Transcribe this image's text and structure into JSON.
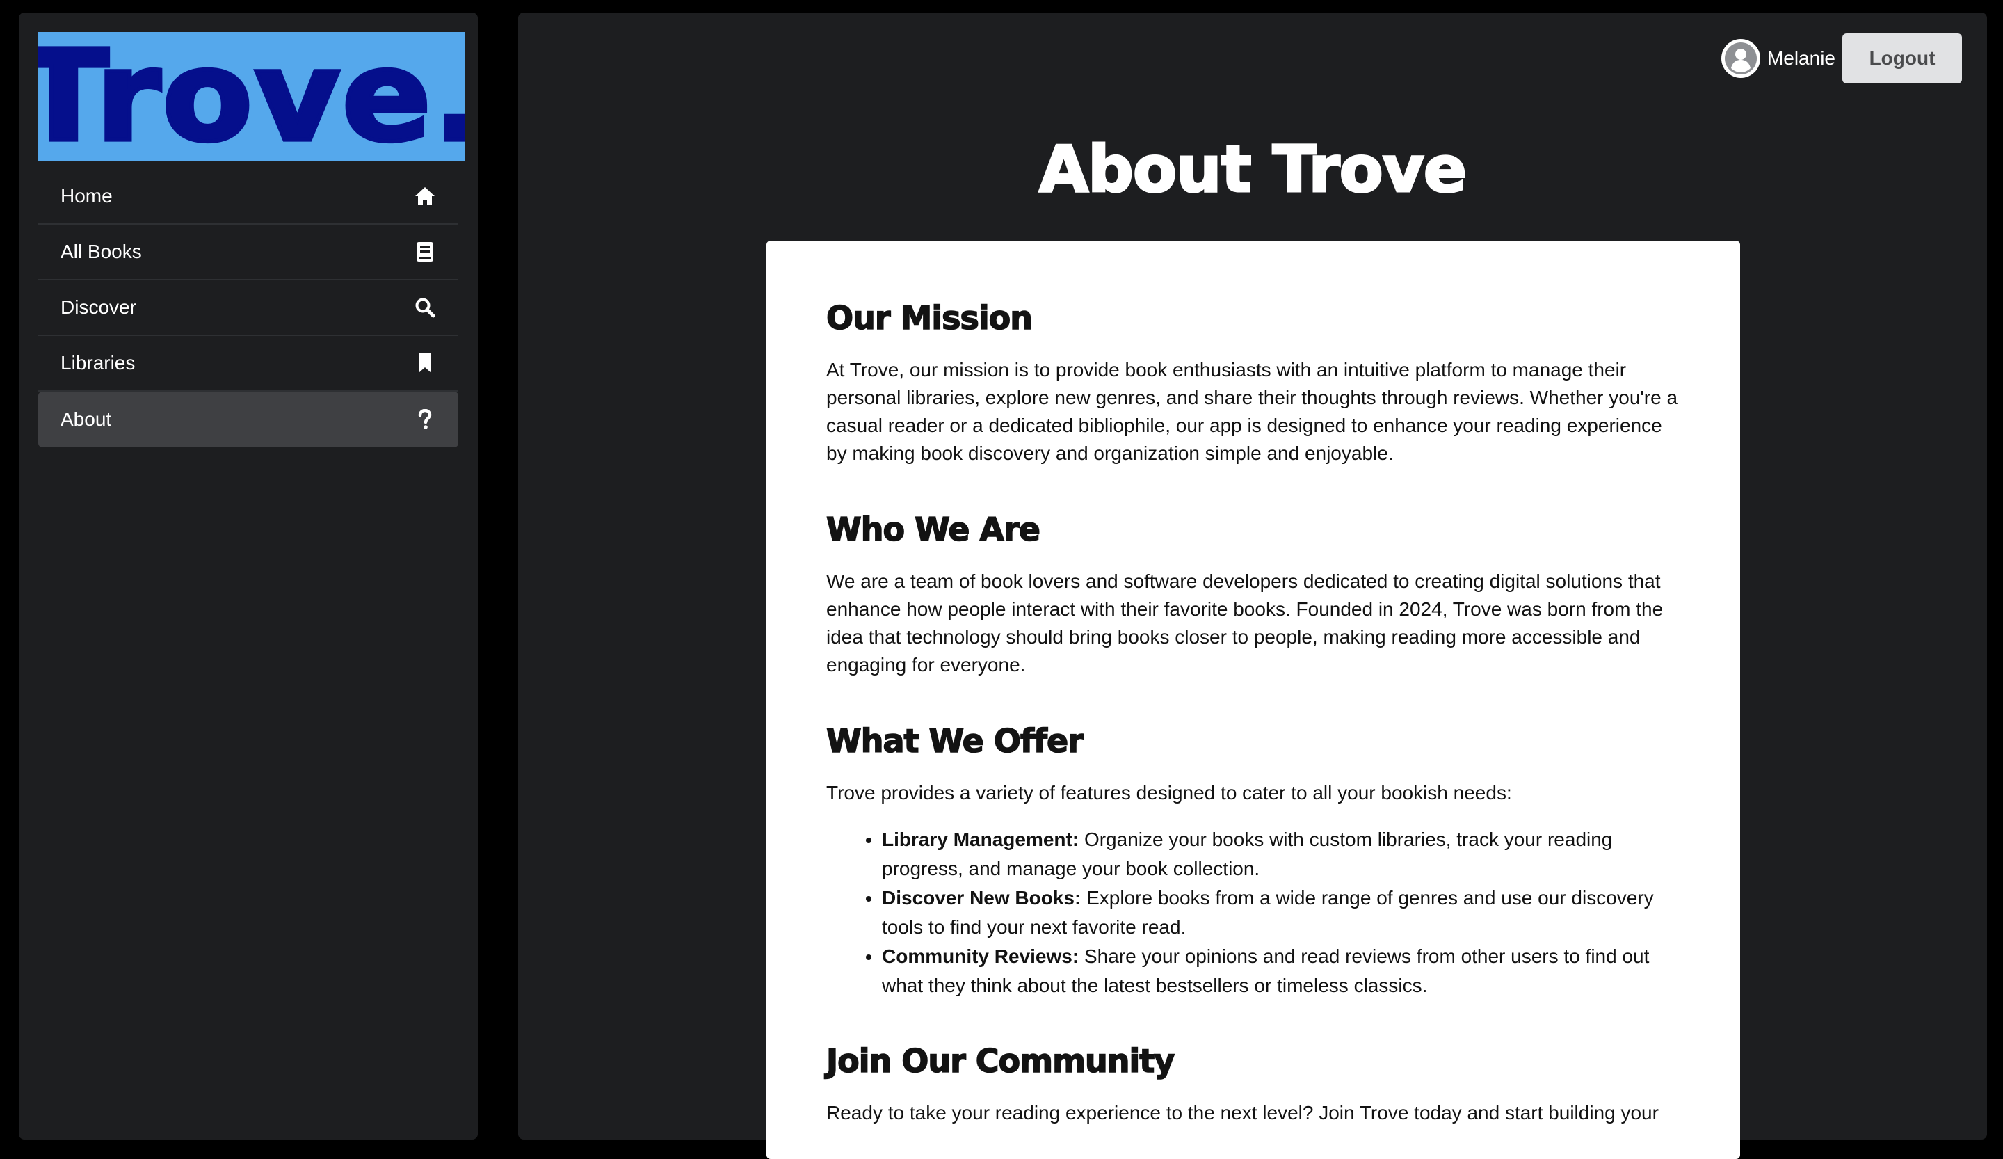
{
  "logo": {
    "text": "Trove."
  },
  "sidebar": {
    "items": [
      {
        "label": "Home",
        "icon": "home-icon",
        "active": false
      },
      {
        "label": "All Books",
        "icon": "book-icon",
        "active": false
      },
      {
        "label": "Discover",
        "icon": "search-icon",
        "active": false
      },
      {
        "label": "Libraries",
        "icon": "bookmark-icon",
        "active": false
      },
      {
        "label": "About",
        "icon": "question-icon",
        "active": true
      }
    ]
  },
  "user": {
    "name": "Melanie",
    "logout_label": "Logout"
  },
  "page": {
    "title": "About Trove"
  },
  "sections": {
    "mission": {
      "heading": "Our Mission",
      "body": "At Trove, our mission is to provide book enthusiasts with an intuitive platform to manage their personal libraries, explore new genres, and share their thoughts through reviews. Whether you're a casual reader or a dedicated bibliophile, our app is designed to enhance your reading experience by making book discovery and organization simple and enjoyable."
    },
    "who": {
      "heading": "Who We Are",
      "body": "We are a team of book lovers and software developers dedicated to creating digital solutions that enhance how people interact with their favorite books. Founded in 2024, Trove was born from the idea that technology should bring books closer to people, making reading more accessible and engaging for everyone."
    },
    "offer": {
      "heading": "What We Offer",
      "intro": "Trove provides a variety of features designed to cater to all your bookish needs:",
      "items": [
        {
          "title": "Library Management:",
          "text": " Organize your books with custom libraries, track your reading progress, and manage your book collection."
        },
        {
          "title": "Discover New Books:",
          "text": " Explore books from a wide range of genres and use our discovery tools to find your next favorite read."
        },
        {
          "title": "Community Reviews:",
          "text": " Share your opinions and read reviews from other users to find out what they think about the latest bestsellers or timeless classics."
        }
      ]
    },
    "join": {
      "heading": "Join Our Community",
      "body": "Ready to take your reading experience to the next level? Join Trove today and start building your"
    }
  },
  "colors": {
    "background": "#000000",
    "panel": "#1d1e20",
    "logo_bg": "#55a8ec",
    "logo_text": "#050f8c",
    "active_nav": "#3f4043"
  }
}
